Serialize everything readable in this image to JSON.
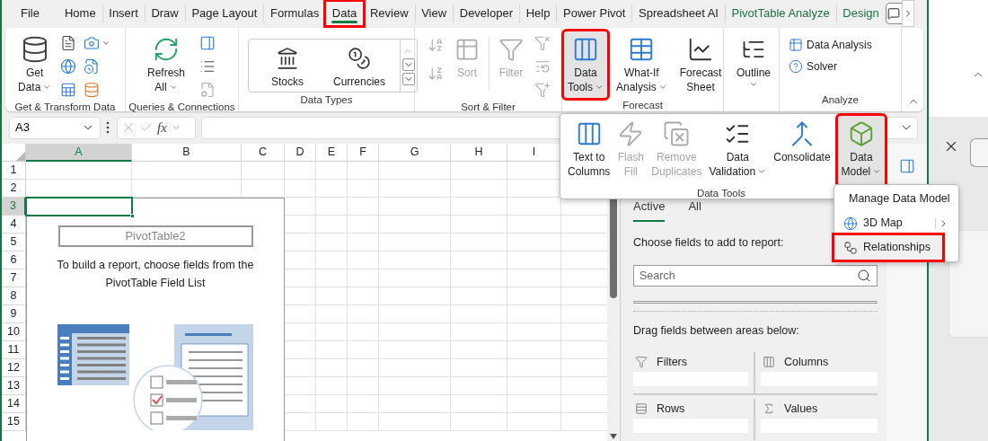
{
  "tabs": [
    {
      "label": "File",
      "selected": false,
      "outlined": false,
      "contextual": false
    },
    {
      "label": "Home",
      "selected": false,
      "outlined": false,
      "contextual": false
    },
    {
      "label": "Insert",
      "selected": false,
      "outlined": false,
      "contextual": false
    },
    {
      "label": "Draw",
      "selected": false,
      "outlined": false,
      "contextual": false
    },
    {
      "label": "Page Layout",
      "selected": false,
      "outlined": false,
      "contextual": false
    },
    {
      "label": "Formulas",
      "selected": false,
      "outlined": false,
      "contextual": false
    },
    {
      "label": "Data",
      "selected": true,
      "outlined": true,
      "contextual": false
    },
    {
      "label": "Review",
      "selected": false,
      "outlined": false,
      "contextual": false
    },
    {
      "label": "View",
      "selected": false,
      "outlined": false,
      "contextual": false
    },
    {
      "label": "Developer",
      "selected": false,
      "outlined": false,
      "contextual": false
    },
    {
      "label": "Help",
      "selected": false,
      "outlined": false,
      "contextual": false
    },
    {
      "label": "Power Pivot",
      "selected": false,
      "outlined": false,
      "contextual": false
    },
    {
      "label": "Spreadsheet AI",
      "selected": false,
      "outlined": false,
      "contextual": false
    },
    {
      "label": "PivotTable Analyze",
      "selected": false,
      "outlined": false,
      "contextual": true
    },
    {
      "label": "Design",
      "selected": false,
      "outlined": false,
      "contextual": true
    }
  ],
  "ribbon": {
    "groups": [
      {
        "kind": "get-transform",
        "label": "Get & Transform Data",
        "buttons": [
          {
            "lines": [
              "Get",
              "Data"
            ],
            "caret": true,
            "disabled": false,
            "pressed": false,
            "outlined": false
          }
        ]
      },
      {
        "kind": "queries",
        "label": "Queries & Connections",
        "buttons": [
          {
            "lines": [
              "Refresh",
              "All"
            ],
            "caret": true,
            "disabled": false,
            "pressed": false,
            "outlined": false
          }
        ]
      },
      {
        "kind": "data-types",
        "label": "Data Types",
        "buttons": [
          {
            "lines": [
              "Stocks"
            ],
            "caret": false,
            "disabled": false,
            "pressed": false,
            "outlined": false
          },
          {
            "lines": [
              "Currencies"
            ],
            "caret": false,
            "disabled": false,
            "pressed": false,
            "outlined": false
          }
        ]
      },
      {
        "kind": "sort-filter",
        "label": "Sort & Filter",
        "buttons": [
          {
            "lines": [
              "Sort"
            ],
            "caret": false,
            "disabled": true,
            "pressed": false,
            "outlined": false
          },
          {
            "lines": [
              "Filter"
            ],
            "caret": false,
            "disabled": true,
            "pressed": false,
            "outlined": false
          }
        ]
      },
      {
        "kind": "forecast",
        "label": "Forecast",
        "buttons": [
          {
            "lines": [
              "Data",
              "Tools"
            ],
            "caret": true,
            "disabled": false,
            "pressed": true,
            "outlined": true
          },
          {
            "lines": [
              "What-If",
              "Analysis"
            ],
            "caret": true,
            "disabled": false,
            "pressed": false,
            "outlined": false
          },
          {
            "lines": [
              "Forecast",
              "Sheet"
            ],
            "caret": false,
            "disabled": false,
            "pressed": false,
            "outlined": false
          }
        ]
      },
      {
        "kind": "outline",
        "buttons": [
          {
            "lines": [
              "Outline"
            ],
            "caret": true,
            "disabled": false,
            "pressed": false,
            "outlined": false
          }
        ]
      },
      {
        "kind": "analyze",
        "label": "Analyze",
        "buttons": [
          {
            "lines": [
              "Data Analysis"
            ],
            "caret": false,
            "disabled": false,
            "pressed": false,
            "outlined": false
          },
          {
            "lines": [
              "Solver"
            ],
            "caret": false,
            "disabled": false,
            "pressed": false,
            "outlined": false
          }
        ]
      }
    ]
  },
  "formula_bar": {
    "name_box": "A3",
    "function_label": "fx"
  },
  "sheet": {
    "columns": [
      {
        "label": "A",
        "selected": true
      },
      {
        "label": "B",
        "selected": false
      },
      {
        "label": "C",
        "selected": false
      },
      {
        "label": "D",
        "selected": false
      },
      {
        "label": "E",
        "selected": false
      },
      {
        "label": "F",
        "selected": false
      },
      {
        "label": "G",
        "selected": false
      },
      {
        "label": "H",
        "selected": false
      },
      {
        "label": "I",
        "selected": false
      }
    ],
    "rows": [
      {
        "label": "1",
        "selected": false
      },
      {
        "label": "2",
        "selected": false
      },
      {
        "label": "3",
        "selected": true
      },
      {
        "label": "4",
        "selected": false
      },
      {
        "label": "5",
        "selected": false
      },
      {
        "label": "6",
        "selected": false
      },
      {
        "label": "7",
        "selected": false
      },
      {
        "label": "8",
        "selected": false
      },
      {
        "label": "9",
        "selected": false
      },
      {
        "label": "10",
        "selected": false
      },
      {
        "label": "11",
        "selected": false
      },
      {
        "label": "12",
        "selected": false
      },
      {
        "label": "13",
        "selected": false
      },
      {
        "label": "14",
        "selected": false
      },
      {
        "label": "15",
        "selected": false
      }
    ]
  },
  "pivot_placeholder": {
    "name": "PivotTable2",
    "message": "To build a report, choose fields from the PivotTable Field List"
  },
  "data_tools_menu": {
    "label": "Data Tools",
    "buttons": [
      {
        "lines": [
          "Text to",
          "Columns"
        ],
        "caret": false,
        "disabled": false,
        "pressed": false,
        "outlined": false
      },
      {
        "lines": [
          "Flash",
          "Fill"
        ],
        "caret": false,
        "disabled": true,
        "pressed": false,
        "outlined": false
      },
      {
        "lines": [
          "Remove",
          "Duplicates"
        ],
        "caret": false,
        "disabled": true,
        "pressed": false,
        "outlined": false
      },
      {
        "lines": [
          "Data",
          "Validation"
        ],
        "caret": true,
        "disabled": false,
        "pressed": false,
        "outlined": false
      },
      {
        "lines": [
          "Consolidate"
        ],
        "caret": false,
        "disabled": false,
        "pressed": false,
        "outlined": false
      },
      {
        "lines": [
          "Data",
          "Model"
        ],
        "caret": true,
        "disabled": false,
        "pressed": true,
        "outlined": true
      }
    ]
  },
  "data_model_menu": {
    "items": [
      {
        "label": "Manage Data Model",
        "submenu": false,
        "highlighted": false,
        "outlined": false
      },
      {
        "label": "3D Map",
        "submenu": true,
        "highlighted": false,
        "outlined": false
      },
      {
        "label": "Relationships",
        "submenu": false,
        "highlighted": true,
        "outlined": true
      }
    ]
  },
  "field_list": {
    "tabs": [
      {
        "label": "Active",
        "selected": true
      },
      {
        "label": "All",
        "selected": false
      }
    ],
    "prompt": "Choose fields to add to report:",
    "search": {
      "placeholder": "Search"
    },
    "areas_prompt": "Drag fields between areas below:",
    "areas": [
      {
        "kind": "filters",
        "label": "Filters"
      },
      {
        "kind": "columns",
        "label": "Columns"
      },
      {
        "kind": "rows",
        "label": "Rows"
      },
      {
        "kind": "values",
        "label": "Values"
      }
    ]
  }
}
